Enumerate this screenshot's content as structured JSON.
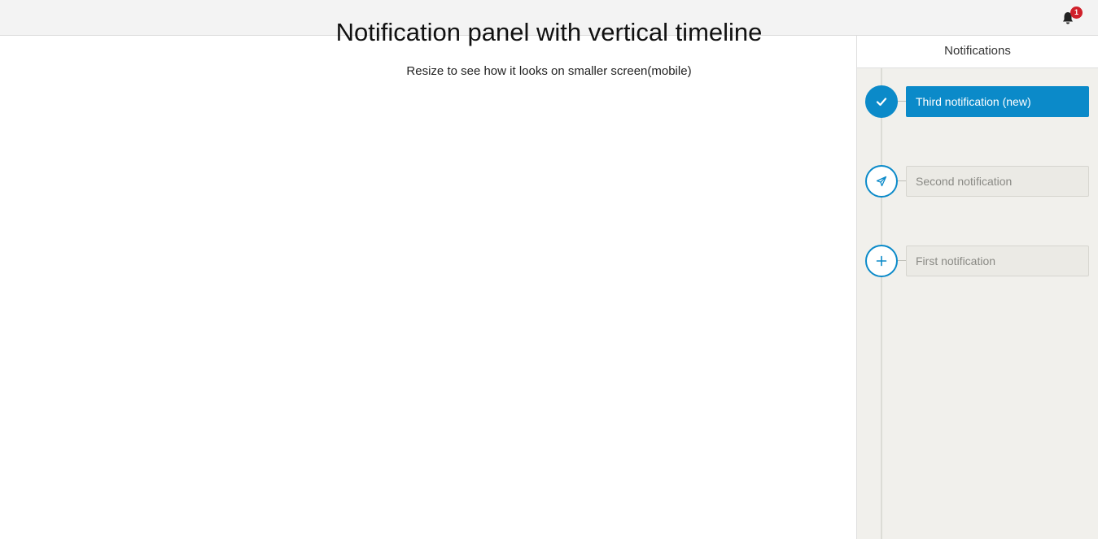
{
  "topbar": {
    "notification_count": "1"
  },
  "main": {
    "title": "Notification panel with vertical timeline",
    "subtitle": "Resize to see how it looks on smaller screen(mobile)"
  },
  "panel": {
    "header": "Notifications",
    "items": [
      {
        "label": "Third notification (new)",
        "icon": "check-icon",
        "state": "new"
      },
      {
        "label": "Second notification",
        "icon": "paper-plane-icon",
        "state": "read"
      },
      {
        "label": "First notification",
        "icon": "plus-icon",
        "state": "read"
      }
    ]
  },
  "colors": {
    "accent": "#0b8ac9",
    "badge": "#d0202a",
    "panel_bg": "#f1f0ec",
    "topbar_bg": "#f3f3f3"
  }
}
